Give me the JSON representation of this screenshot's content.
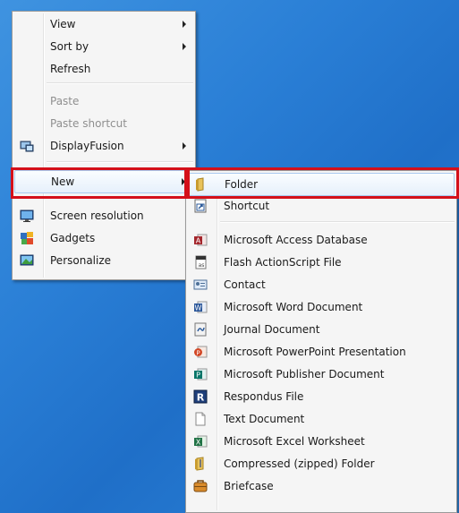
{
  "context_menu": {
    "items": [
      {
        "label": "View",
        "has_submenu": true
      },
      {
        "label": "Sort by",
        "has_submenu": true
      },
      {
        "label": "Refresh"
      },
      {
        "label": "Paste",
        "disabled": true
      },
      {
        "label": "Paste shortcut",
        "disabled": true
      },
      {
        "label": "DisplayFusion",
        "has_submenu": true,
        "icon": "displayfusion-icon"
      },
      {
        "label": "New",
        "has_submenu": true,
        "selected": true
      },
      {
        "label": "Screen resolution",
        "icon": "monitor-icon"
      },
      {
        "label": "Gadgets",
        "icon": "gadgets-icon"
      },
      {
        "label": "Personalize",
        "icon": "personalize-icon"
      }
    ]
  },
  "new_submenu": {
    "items": [
      {
        "label": "Folder",
        "icon": "folder-icon",
        "selected": true
      },
      {
        "label": "Shortcut",
        "icon": "shortcut-icon"
      },
      {
        "label": "Microsoft Access Database",
        "icon": "access-icon"
      },
      {
        "label": "Flash ActionScript File",
        "icon": "actionscript-icon"
      },
      {
        "label": "Contact",
        "icon": "contact-icon"
      },
      {
        "label": "Microsoft Word Document",
        "icon": "word-icon"
      },
      {
        "label": "Journal Document",
        "icon": "journal-icon"
      },
      {
        "label": "Microsoft PowerPoint Presentation",
        "icon": "powerpoint-icon"
      },
      {
        "label": "Microsoft Publisher Document",
        "icon": "publisher-icon"
      },
      {
        "label": "Respondus File",
        "icon": "respondus-icon"
      },
      {
        "label": "Text Document",
        "icon": "text-document-icon"
      },
      {
        "label": "Microsoft Excel Worksheet",
        "icon": "excel-icon"
      },
      {
        "label": "Compressed (zipped) Folder",
        "icon": "zip-folder-icon"
      },
      {
        "label": "Briefcase",
        "icon": "briefcase-icon"
      }
    ]
  },
  "colors": {
    "highlight_outline": "#d4101a",
    "desktop": "#2a7fd6"
  }
}
